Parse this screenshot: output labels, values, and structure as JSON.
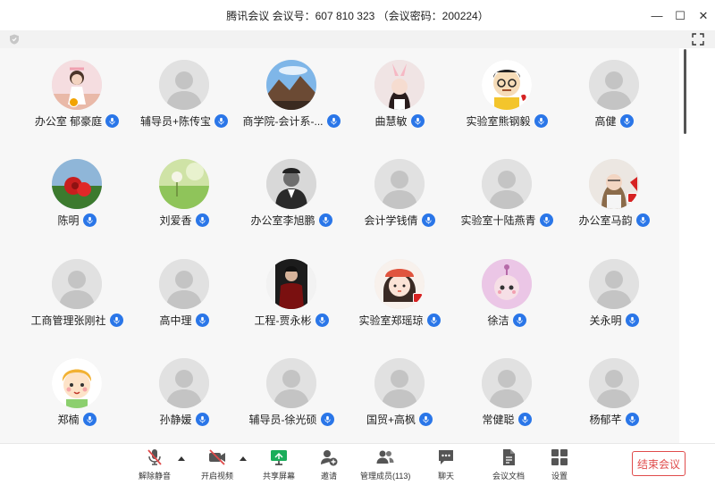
{
  "window": {
    "title": "腾讯会议 会议号：607 810 323 （会议密码：200224）"
  },
  "colors": {
    "accent": "#2a76e8",
    "end": "#e04b4b",
    "share": "#1aad5a"
  },
  "participants": [
    {
      "name": "办公室 郁豪庭",
      "avatar": "photo-girl",
      "badge": true
    },
    {
      "name": "辅导员+陈传宝",
      "avatar": "default"
    },
    {
      "name": "商学院-会计系-...",
      "avatar": "photo-landscape"
    },
    {
      "name": "曲慧敏",
      "avatar": "photo-bunny"
    },
    {
      "name": "实验室熊钢毅",
      "avatar": "cartoon-man"
    },
    {
      "name": "高健",
      "avatar": "default"
    },
    {
      "name": "陈明",
      "avatar": "photo-rose"
    },
    {
      "name": "刘爱香",
      "avatar": "photo-field"
    },
    {
      "name": "办公室李旭鹏",
      "avatar": "photo-man-bw"
    },
    {
      "name": "会计学钱倩",
      "avatar": "default"
    },
    {
      "name": "实验室十陆燕青",
      "avatar": "default"
    },
    {
      "name": "办公室马韵",
      "avatar": "photo-woman",
      "flag": true
    },
    {
      "name": "工商管理张刚社",
      "avatar": "default"
    },
    {
      "name": "高中理",
      "avatar": "default"
    },
    {
      "name": "工程-贾永彬",
      "avatar": "photo-man-dark"
    },
    {
      "name": "实验室郑瑶琼",
      "avatar": "cartoon-girl",
      "flag": true
    },
    {
      "name": "徐洁",
      "avatar": "cartoon-alien"
    },
    {
      "name": "关永明",
      "avatar": "default"
    },
    {
      "name": "郑楠",
      "avatar": "cartoon-kid"
    },
    {
      "name": "孙静媛",
      "avatar": "default"
    },
    {
      "name": "辅导员-徐光硕",
      "avatar": "default"
    },
    {
      "name": "国贸+高枫",
      "avatar": "default"
    },
    {
      "name": "常健聪",
      "avatar": "default"
    },
    {
      "name": "杨郁芊",
      "avatar": "default"
    }
  ],
  "toolbar": {
    "mute": "解除静音",
    "video": "开启视频",
    "share": "共享屏幕",
    "invite": "邀请",
    "members": "管理成员(113)",
    "chat": "聊天",
    "docs": "会议文档",
    "settings": "设置",
    "end": "结束会议"
  }
}
